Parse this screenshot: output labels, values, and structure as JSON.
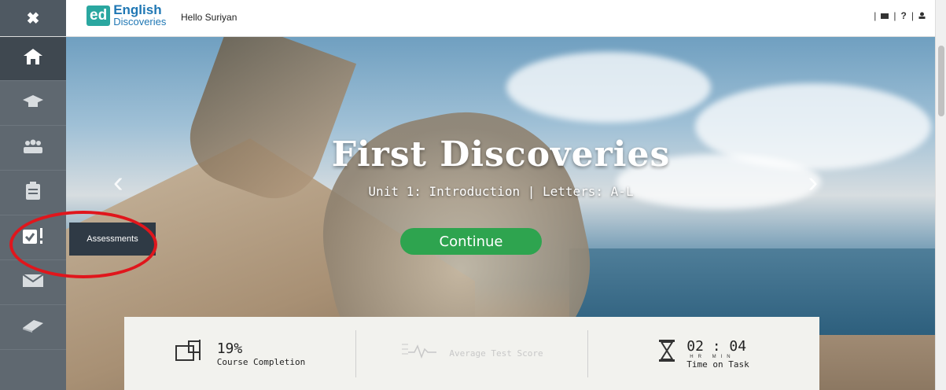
{
  "header": {
    "close_icon": "✖",
    "logo_ed": "ed",
    "logo_line1": "English",
    "logo_line2": "Discoveries",
    "greeting": "Hello Suriyan",
    "icons": [
      "mail-icon",
      "help-icon",
      "user-icon"
    ],
    "sep": "|",
    "help_label": "?"
  },
  "sidebar": {
    "items": [
      {
        "name": "home",
        "icon": "home-icon"
      },
      {
        "name": "courses",
        "icon": "graduation-cap-icon"
      },
      {
        "name": "community",
        "icon": "group-icon"
      },
      {
        "name": "clipboard",
        "icon": "clipboard-icon"
      },
      {
        "name": "assessments",
        "icon": "assessment-icon"
      },
      {
        "name": "messages",
        "icon": "envelope-icon"
      },
      {
        "name": "library",
        "icon": "book-icon"
      }
    ],
    "tooltip": "Assessments"
  },
  "hero": {
    "title": "First Discoveries",
    "subtitle": "Unit 1: Introduction | Letters: A-L",
    "button": "Continue"
  },
  "stats": {
    "completion_value": "19%",
    "completion_label": "Course Completion",
    "score_label": "Average Test Score",
    "time_value": "02 : 04",
    "time_units": "HR MIN",
    "time_label": "Time on Task"
  },
  "colors": {
    "accent": "#2ea44f",
    "sidebar": "#5f6870",
    "highlight": "#e0161c"
  }
}
